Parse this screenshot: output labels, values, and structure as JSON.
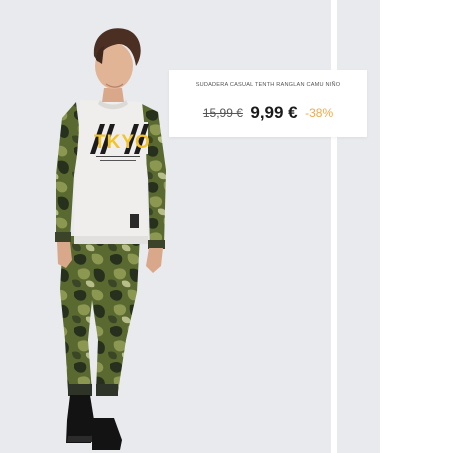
{
  "product": {
    "name": "SUDADERA CASUAL TENTH RANGLAN CAMU NIÑO",
    "old_price": "15,99 €",
    "price": "9,99 €",
    "discount": "-38%",
    "image": {
      "print_text": "TKYO",
      "background_color": "#e9eaee"
    }
  },
  "colors": {
    "discount": "#f0a94b",
    "price": "#1b1b1b"
  }
}
